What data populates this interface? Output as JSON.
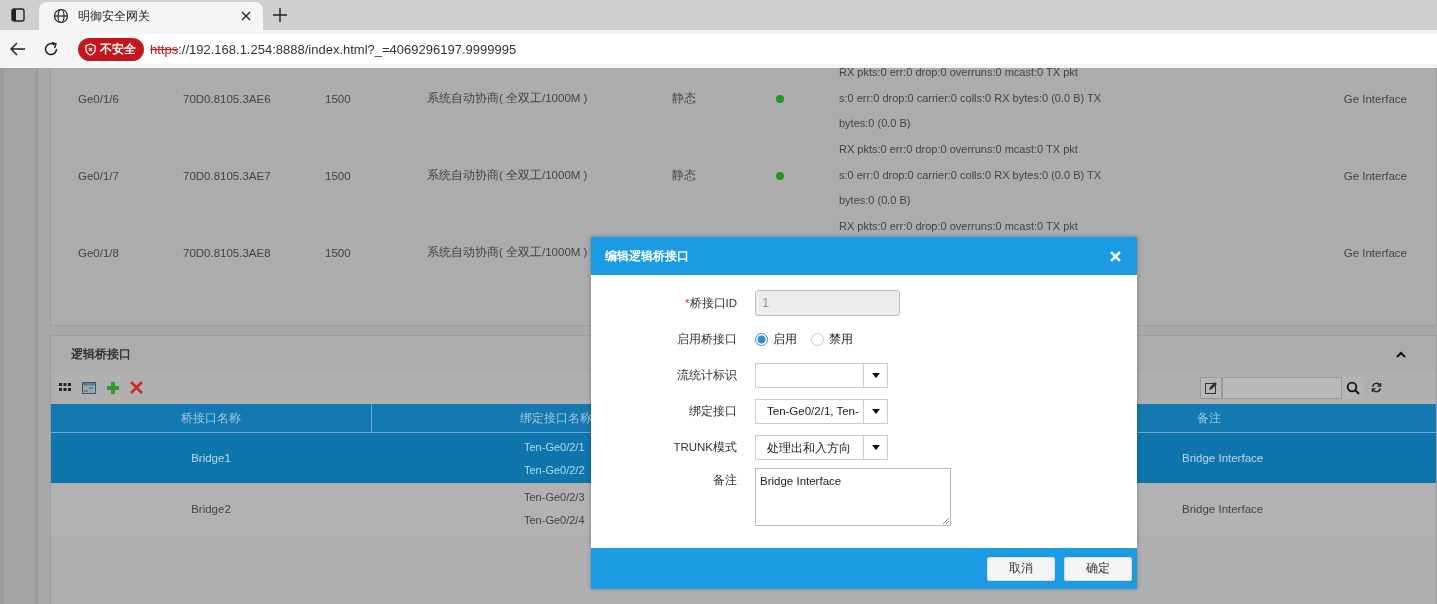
{
  "browser": {
    "tab_title": "明御安全网关",
    "security_label": "不安全",
    "url_scheme": "https",
    "url_rest": "://192.168.1.254:8888/index.html?_=4069296197.9999995"
  },
  "interfaces": [
    {
      "name": "Ge0/1/6",
      "mac": "70D0.8105.3AE6",
      "mtu": "1500",
      "duplex": "系统自动协商( 全双工/1000M )",
      "mode": "静态",
      "online": true,
      "stats": [
        "RX pkts:0 err:0 drop:0 overruns:0 mcast:0 TX pkt",
        "s:0 err:0 drop:0 carrier:0 colls:0 RX bytes:0 (0.0 B) TX",
        "bytes:0 (0.0 B)"
      ],
      "type": "Ge Interface"
    },
    {
      "name": "Ge0/1/7",
      "mac": "70D0.8105.3AE7",
      "mtu": "1500",
      "duplex": "系统自动协商( 全双工/1000M )",
      "mode": "静态",
      "online": true,
      "stats": [
        "RX pkts:0 err:0 drop:0 overruns:0 mcast:0 TX pkt",
        "s:0 err:0 drop:0 carrier:0 colls:0 RX bytes:0 (0.0 B) TX",
        "bytes:0 (0.0 B)"
      ],
      "type": "Ge Interface"
    },
    {
      "name": "Ge0/1/8",
      "mac": "70D0.8105.3AE8",
      "mtu": "1500",
      "duplex": "系统自动协商( 全双工/1000M )",
      "stats": [
        "RX pkts:0 err:0 drop:0 overruns:0 mcast:0 TX pkt"
      ],
      "type": "Ge Interface"
    }
  ],
  "bridge_panel": {
    "title": "逻辑桥接口",
    "expanded": true,
    "columns": [
      "桥接口名称",
      "绑定接口名称",
      "备注"
    ],
    "rows": [
      {
        "name": "Bridge1",
        "bindings": [
          "Ten-Ge0/2/1",
          "Ten-Ge0/2/2"
        ],
        "remark": "Bridge Interface",
        "selected": true
      },
      {
        "name": "Bridge2",
        "bindings": [
          "Ten-Ge0/2/3",
          "Ten-Ge0/2/4"
        ],
        "remark": "Bridge Interface",
        "selected": false
      }
    ]
  },
  "dialog": {
    "title": "编辑逻辑桥接口",
    "fields": [
      {
        "kind": "text",
        "label": "桥接口ID",
        "required_mark": "*",
        "value": "1",
        "disabled": true
      },
      {
        "kind": "radio",
        "label": "启用桥接口",
        "options": [
          {
            "label": "启用",
            "selected": true
          },
          {
            "label": "禁用",
            "selected": false
          }
        ]
      },
      {
        "kind": "select",
        "label": "流统计标识"
      },
      {
        "kind": "select",
        "label": "绑定接口",
        "value": "Ten-Ge0/2/1, Ten-"
      },
      {
        "kind": "select",
        "label": "TRUNK模式",
        "value": "处理出和入方向"
      },
      {
        "kind": "textarea",
        "label": "备注",
        "value": "Bridge Interface"
      }
    ],
    "buttons": [
      "取消",
      "确定"
    ]
  }
}
